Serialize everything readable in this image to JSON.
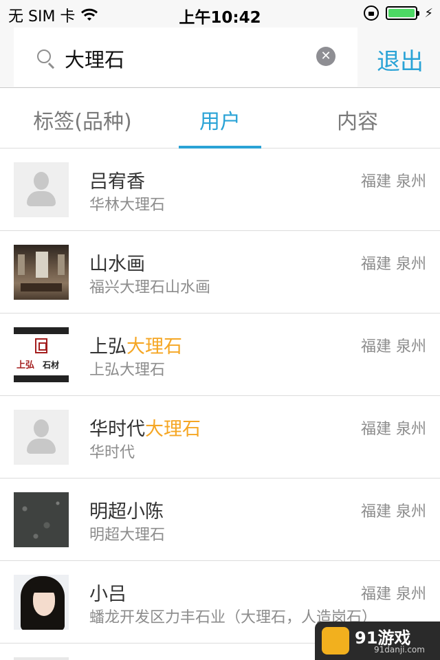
{
  "status_bar": {
    "carrier": "无 SIM 卡",
    "time": "上午10:42",
    "battery_level": 1.0
  },
  "search": {
    "query": "大理石",
    "exit_label": "退出"
  },
  "tabs": [
    {
      "label": "标签(品种)",
      "active": false
    },
    {
      "label": "用户",
      "active": true
    },
    {
      "label": "内容",
      "active": false
    }
  ],
  "results": [
    {
      "name_plain": "吕宥香",
      "name_highlight": "",
      "subtitle": "华林大理石",
      "location": "福建 泉州",
      "avatar": "default-avatar"
    },
    {
      "name_plain": "山水画",
      "name_highlight": "",
      "subtitle": "福兴大理石山水画",
      "location": "福建 泉州",
      "avatar": "interior-photo"
    },
    {
      "name_plain": "上弘",
      "name_highlight": "大理石",
      "subtitle": "上弘大理石",
      "location": "福建 泉州",
      "avatar": "brand-logo"
    },
    {
      "name_plain": "华时代",
      "name_highlight": "大理石",
      "subtitle": "华时代",
      "location": "福建 泉州",
      "avatar": "default-avatar"
    },
    {
      "name_plain": "明超小陈",
      "name_highlight": "",
      "subtitle": "明超大理石",
      "location": "福建 泉州",
      "avatar": "granite-photo"
    },
    {
      "name_plain": "小吕",
      "name_highlight": "",
      "subtitle": "蟠龙开发区力丰石业（大理石，人造岗石）",
      "location": "福建 泉州",
      "avatar": "girl-photo"
    }
  ],
  "logo_text": {
    "brand_a": "上弘",
    "brand_b": "石材"
  },
  "watermark": {
    "title": "91游戏",
    "url": "91danji.com"
  },
  "colors": {
    "accent": "#2aa3d6",
    "highlight": "#f5a623",
    "battery": "#4cd964"
  }
}
